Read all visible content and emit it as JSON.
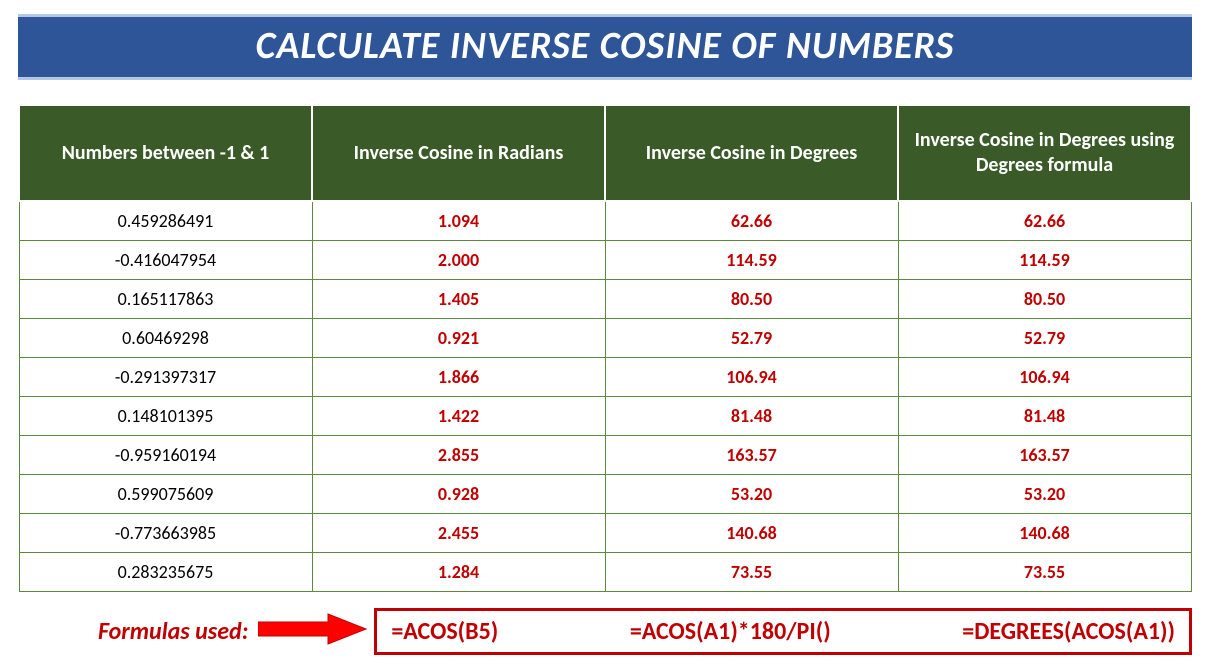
{
  "title": "CALCULATE INVERSE COSINE OF NUMBERS",
  "headers": {
    "col1": "Numbers between -1 & 1",
    "col2": "Inverse Cosine in Radians",
    "col3": "Inverse Cosine in Degrees",
    "col4": "Inverse Cosine in Degrees using Degrees formula"
  },
  "rows": [
    {
      "num": "0.459286491",
      "rad": "1.094",
      "deg": "62.66",
      "degf": "62.66"
    },
    {
      "num": "-0.416047954",
      "rad": "2.000",
      "deg": "114.59",
      "degf": "114.59"
    },
    {
      "num": "0.165117863",
      "rad": "1.405",
      "deg": "80.50",
      "degf": "80.50"
    },
    {
      "num": "0.60469298",
      "rad": "0.921",
      "deg": "52.79",
      "degf": "52.79"
    },
    {
      "num": "-0.291397317",
      "rad": "1.866",
      "deg": "106.94",
      "degf": "106.94"
    },
    {
      "num": "0.148101395",
      "rad": "1.422",
      "deg": "81.48",
      "degf": "81.48"
    },
    {
      "num": "-0.959160194",
      "rad": "2.855",
      "deg": "163.57",
      "degf": "163.57"
    },
    {
      "num": "0.599075609",
      "rad": "0.928",
      "deg": "53.20",
      "degf": "53.20"
    },
    {
      "num": "-0.773663985",
      "rad": "2.455",
      "deg": "140.68",
      "degf": "140.68"
    },
    {
      "num": "0.283235675",
      "rad": "1.284",
      "deg": "73.55",
      "degf": "73.55"
    }
  ],
  "formulas": {
    "label": "Formulas used:",
    "f1": "=ACOS(B5)",
    "f2": "=ACOS(A1)*180/PI()",
    "f3": "=DEGREES(ACOS(A1))"
  },
  "colors": {
    "header_bg": "#2e5597",
    "table_header_bg": "#3a5a28",
    "accent_red": "#c00000",
    "border_green": "#5a8a3a"
  }
}
